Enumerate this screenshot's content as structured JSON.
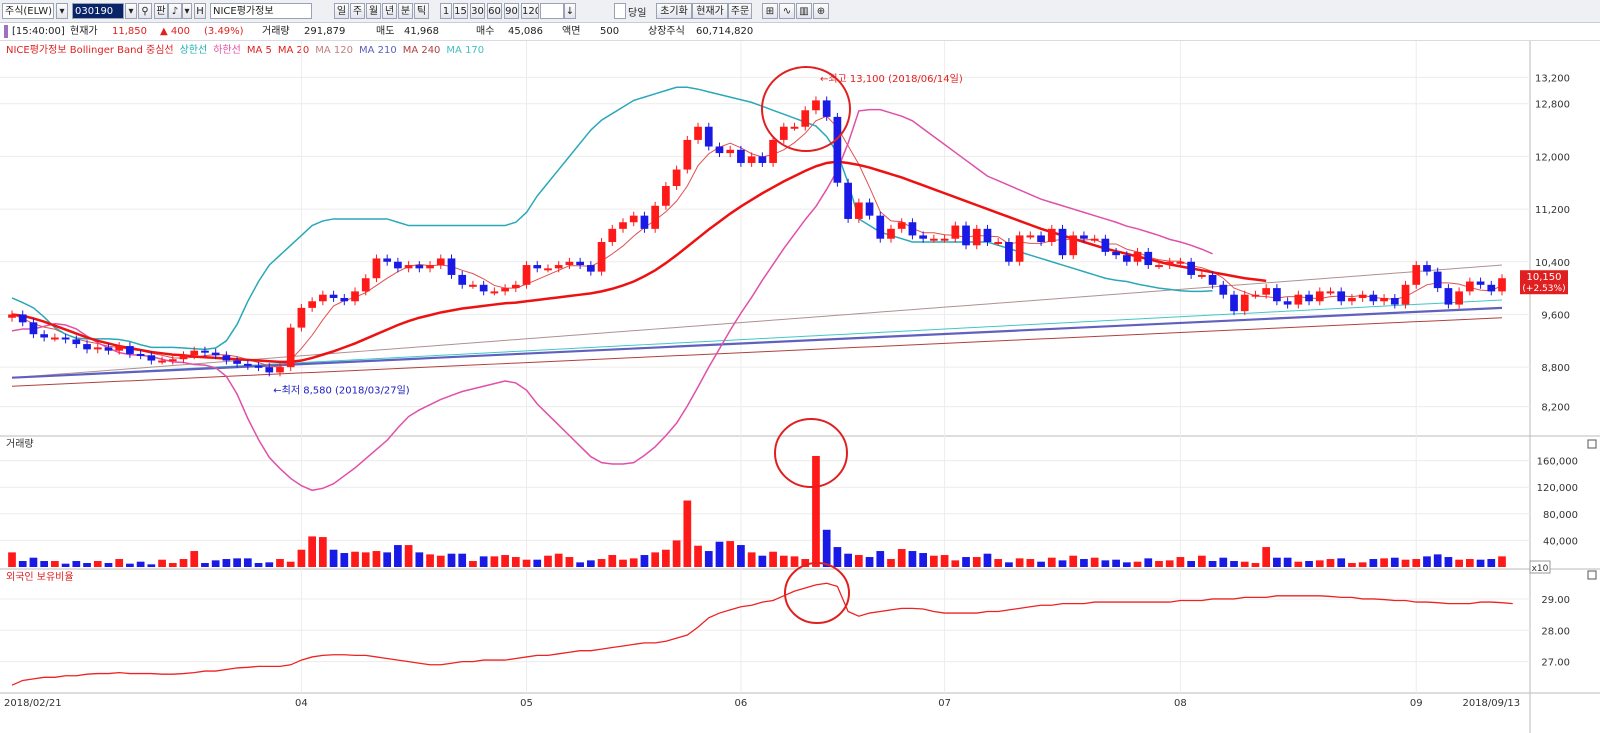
{
  "toolbar": {
    "market_select": "주식(ELW)",
    "code_input": "030190",
    "type_label": "판",
    "name_input": "NICE평가정보",
    "periods": [
      "일",
      "주",
      "월",
      "년",
      "분",
      "틱"
    ],
    "intervals": [
      "1",
      "15",
      "30",
      "60",
      "90",
      "120"
    ],
    "count_field": "",
    "today_label": "당일",
    "reset_label": "초기화",
    "current_price_label": "현재가",
    "order_label": "주문"
  },
  "infobar": {
    "time": "[15:40:00]",
    "price_label": "현재가",
    "price": "11,850",
    "change": "▲ 400",
    "change_pct": "(3.49%)",
    "volume_label": "거래량",
    "volume": "291,879",
    "sell_label": "매도",
    "sell": "41,968",
    "buy_label": "매수",
    "buy": "45,086",
    "par_label": "액면",
    "par": "500",
    "listed_label": "상장주식",
    "listed": "60,714,820"
  },
  "legend": [
    {
      "text": "NICE평가정보 Bollinger Band 중심선",
      "color": "#e02020"
    },
    {
      "text": "상한선",
      "color": "#20b0b0"
    },
    {
      "text": "하한선",
      "color": "#e050a0"
    },
    {
      "text": "MA 5",
      "color": "#e02020"
    },
    {
      "text": "MA 20",
      "color": "#e02020"
    },
    {
      "text": "MA 120",
      "color": "#c08080"
    },
    {
      "text": "MA 210",
      "color": "#6060c0"
    },
    {
      "text": "MA 240",
      "color": "#b04040"
    },
    {
      "text": "MA 170",
      "color": "#40c0c0"
    }
  ],
  "panels": {
    "volume_title": "거래량",
    "foreign_title": "외국인 보유비율",
    "volume_unit": "x10"
  },
  "colors": {
    "up": "#ff1a1a",
    "down": "#1a1ae6",
    "upper": "#2aa8b8",
    "lower": "#e050a8",
    "mid": "#ee1111"
  },
  "chart_data": [
    {
      "type": "candlestick",
      "title": "NICE평가정보",
      "ylim": [
        7800,
        13600
      ],
      "yticks": [
        8200,
        8800,
        9600,
        10400,
        11200,
        12000,
        12800,
        13200
      ],
      "ytick_labels": [
        "8,200",
        "8,800",
        "9,600",
        "10,400",
        "11,200",
        "12,000",
        "12,800",
        "13,200"
      ],
      "x_labels": [
        {
          "text": "2018/02/21",
          "index": 0
        },
        {
          "text": "04",
          "index": 27
        },
        {
          "text": "05",
          "index": 48
        },
        {
          "text": "06",
          "index": 68
        },
        {
          "text": "07",
          "index": 87
        },
        {
          "text": "08",
          "index": 109
        },
        {
          "text": "09",
          "index": 131
        },
        {
          "text": "2018/09/13",
          "index": 138
        }
      ],
      "last_price_label": "10,150",
      "last_change_label": "(+2.53%)",
      "annotations": [
        {
          "text": "←최고 13,100 (2018/06/14일)",
          "index": 75,
          "value": 13100
        },
        {
          "text": "←최저 8,580 (2018/03/27일)",
          "index": 24,
          "value": 8580
        }
      ],
      "close": [
        9600,
        9480,
        9300,
        9250,
        9250,
        9220,
        9150,
        9070,
        9100,
        9050,
        9120,
        9000,
        8980,
        8900,
        8900,
        8920,
        8980,
        9050,
        9020,
        8980,
        8900,
        8850,
        8820,
        8800,
        8720,
        8800,
        9400,
        9700,
        9800,
        9900,
        9850,
        9800,
        9950,
        10150,
        10450,
        10400,
        10300,
        10350,
        10300,
        10350,
        10450,
        10200,
        10050,
        10050,
        9950,
        9950,
        10000,
        10050,
        10350,
        10300,
        10300,
        10350,
        10400,
        10350,
        10250,
        10700,
        10900,
        11000,
        11100,
        10900,
        11250,
        11550,
        11800,
        12250,
        12450,
        12150,
        12050,
        12100,
        11900,
        12000,
        11900,
        12250,
        12450,
        12450,
        12700,
        12850,
        12600,
        11600,
        11050,
        11300,
        11100,
        10750,
        10900,
        11000,
        10800,
        10750,
        10750,
        10750,
        10950,
        10650,
        10900,
        10700,
        10700,
        10400,
        10800,
        10800,
        10700,
        10900,
        10500,
        10800,
        10750,
        10750,
        10550,
        10500,
        10400,
        10550,
        10350,
        10350,
        10400,
        10400,
        10200,
        10200,
        10050,
        9900,
        9650,
        9900,
        9900,
        10000,
        9800,
        9750,
        9900,
        9800,
        9950,
        9950,
        9800,
        9850,
        9900,
        9800,
        9850,
        9750,
        10050,
        10350,
        10250,
        10000,
        9750,
        9950,
        10100,
        10050,
        9950,
        10150
      ],
      "open": [
        9550,
        9600,
        9480,
        9300,
        9250,
        9250,
        9220,
        9150,
        9070,
        9100,
        9050,
        9120,
        9000,
        8980,
        8900,
        8900,
        8920,
        8980,
        9050,
        9020,
        8980,
        8900,
        8850,
        8820,
        8800,
        8720,
        8800,
        9400,
        9700,
        9800,
        9900,
        9850,
        9800,
        9950,
        10150,
        10450,
        10400,
        10300,
        10350,
        10300,
        10350,
        10450,
        10200,
        10050,
        10050,
        9950,
        9950,
        10000,
        10050,
        10350,
        10300,
        10300,
        10350,
        10400,
        10350,
        10250,
        10700,
        10900,
        11000,
        11100,
        10900,
        11250,
        11550,
        11800,
        12250,
        12450,
        12150,
        12050,
        12100,
        11900,
        12000,
        11900,
        12250,
        12450,
        12450,
        12700,
        12850,
        12600,
        11600,
        11050,
        11300,
        11100,
        10750,
        10900,
        11000,
        10800,
        10750,
        10750,
        10750,
        10950,
        10650,
        10900,
        10700,
        10700,
        10400,
        10800,
        10800,
        10700,
        10900,
        10500,
        10800,
        10750,
        10750,
        10550,
        10500,
        10400,
        10550,
        10350,
        10350,
        10400,
        10400,
        10200,
        10200,
        10050,
        9900,
        9650,
        9900,
        9900,
        10000,
        9800,
        9750,
        9900,
        9800,
        9950,
        9950,
        9800,
        9850,
        9900,
        9800,
        9850,
        9750,
        10050,
        10350,
        10250,
        10000,
        9750,
        9950,
        10100,
        10050,
        9950
      ],
      "series": [
        {
          "name": "상한선",
          "values": [
            9850,
            9780,
            9700,
            9560,
            9400,
            9300,
            9240,
            9230,
            9230,
            9230,
            9220,
            9190,
            9140,
            9100,
            9100,
            9100,
            9090,
            9080,
            9070,
            9090,
            9200,
            9450,
            9800,
            10100,
            10350,
            10500,
            10650,
            10800,
            10950,
            11020,
            11050,
            11050,
            11050,
            11050,
            11050,
            11050,
            11000,
            10950,
            10950,
            10950,
            10950,
            10950,
            10950,
            10950,
            10950,
            10950,
            10950,
            11000,
            11150,
            11400,
            11600,
            11800,
            12000,
            12200,
            12400,
            12550,
            12650,
            12750,
            12850,
            12900,
            12950,
            13000,
            13050,
            13050,
            13020,
            12980,
            12940,
            12900,
            12860,
            12820,
            12760,
            12700,
            12640,
            12580,
            12520,
            12460,
            12300,
            12050,
            11600,
            11050,
            10950,
            10850,
            10800,
            10750,
            10700,
            10700,
            10700,
            10700,
            10700,
            10700,
            10700,
            10700,
            10650,
            10600,
            10550,
            10500,
            10450,
            10400,
            10350,
            10300,
            10250,
            10200,
            10150,
            10120,
            10100,
            10060,
            10030,
            10000,
            9980,
            9960,
            9950,
            9950,
            9960
          ]
        },
        {
          "name": "중심선",
          "values": [
            9600,
            9580,
            9540,
            9490,
            9430,
            9370,
            9310,
            9250,
            9200,
            9160,
            9120,
            9090,
            9060,
            9030,
            9010,
            8990,
            8980,
            8960,
            8950,
            8940,
            8930,
            8920,
            8910,
            8900,
            8890,
            8880,
            8880,
            8900,
            8940,
            8990,
            9040,
            9100,
            9160,
            9230,
            9300,
            9370,
            9440,
            9500,
            9550,
            9590,
            9630,
            9660,
            9690,
            9710,
            9730,
            9750,
            9770,
            9780,
            9800,
            9820,
            9840,
            9860,
            9880,
            9900,
            9920,
            9950,
            9990,
            10040,
            10100,
            10180,
            10270,
            10380,
            10500,
            10630,
            10760,
            10890,
            11010,
            11130,
            11240,
            11340,
            11440,
            11530,
            11620,
            11700,
            11780,
            11850,
            11900,
            11920,
            11900,
            11870,
            11830,
            11780,
            11730,
            11680,
            11620,
            11560,
            11500,
            11440,
            11380,
            11320,
            11260,
            11200,
            11140,
            11080,
            11020,
            10960,
            10900,
            10850,
            10800,
            10750,
            10700,
            10650,
            10600,
            10560,
            10520,
            10480,
            10440,
            10400,
            10360,
            10330,
            10300,
            10270,
            10240,
            10210,
            10180,
            10150,
            10130,
            10110
          ]
        }
      ]
    },
    {
      "type": "bar",
      "title": "거래량",
      "unit": "x10",
      "ylim": [
        0,
        185000
      ],
      "yticks": [
        40000,
        80000,
        120000,
        160000
      ],
      "ytick_labels": [
        "40,000",
        "80,000",
        "120,000",
        "160,000"
      ],
      "values": [
        22000,
        9000,
        14000,
        9000,
        9000,
        5000,
        9000,
        6000,
        9000,
        6000,
        12000,
        5000,
        8000,
        4000,
        11000,
        6000,
        12000,
        24000,
        6000,
        10000,
        12000,
        13000,
        13000,
        6000,
        7000,
        12000,
        8000,
        26000,
        46000,
        45000,
        26000,
        21000,
        23000,
        22000,
        24000,
        22000,
        33000,
        33000,
        22000,
        19000,
        17000,
        20000,
        20000,
        9000,
        16000,
        16000,
        18000,
        15000,
        11000,
        11000,
        17000,
        20000,
        15000,
        7000,
        10000,
        12000,
        18000,
        11000,
        13000,
        18000,
        22000,
        26000,
        40000,
        100000,
        32000,
        24000,
        38000,
        39000,
        33000,
        22000,
        17000,
        23000,
        17000,
        16000,
        12000,
        167000,
        56000,
        30000,
        20000,
        18000,
        15000,
        24000,
        12000,
        27000,
        24000,
        21000,
        17000,
        18000,
        10000,
        15000,
        15000,
        20000,
        12000,
        7000,
        13000,
        12000,
        8000,
        14000,
        10000,
        17000,
        12000,
        14000,
        10000,
        11000,
        7000,
        8000,
        13000,
        9000,
        10000,
        15000,
        9000,
        17000,
        9000,
        14000,
        9000,
        8000,
        6000,
        30000,
        14000,
        14000,
        8000,
        9000,
        10000,
        12000,
        13000,
        6000,
        7000,
        12000,
        13000,
        14000,
        11000,
        12000,
        16000,
        19000,
        15000,
        11000,
        12000,
        11000,
        12000,
        16000,
        11000,
        9000
      ]
    },
    {
      "type": "line",
      "title": "외국인 보유비율",
      "ylim": [
        26.0,
        29.7
      ],
      "yticks": [
        27.0,
        28.0,
        29.0
      ],
      "ytick_labels": [
        "27.00",
        "28.00",
        "29.00"
      ],
      "series": [
        {
          "name": "외국인 보유비율",
          "values": [
            26.25,
            26.4,
            26.45,
            26.5,
            26.5,
            26.55,
            26.55,
            26.6,
            26.62,
            26.62,
            26.65,
            26.62,
            26.62,
            26.62,
            26.6,
            26.6,
            26.62,
            26.65,
            26.7,
            26.7,
            26.75,
            26.8,
            26.82,
            26.85,
            26.85,
            26.85,
            26.9,
            27.05,
            27.15,
            27.2,
            27.22,
            27.22,
            27.2,
            27.2,
            27.15,
            27.1,
            27.05,
            27.0,
            26.95,
            26.9,
            26.9,
            26.95,
            27.0,
            27.0,
            27.05,
            27.05,
            27.05,
            27.1,
            27.15,
            27.2,
            27.2,
            27.25,
            27.3,
            27.35,
            27.35,
            27.4,
            27.45,
            27.5,
            27.55,
            27.6,
            27.6,
            27.65,
            27.75,
            27.85,
            28.1,
            28.4,
            28.55,
            28.65,
            28.75,
            28.8,
            28.9,
            28.95,
            29.1,
            29.25,
            29.35,
            29.45,
            29.5,
            29.4,
            28.6,
            28.45,
            28.55,
            28.6,
            28.65,
            28.7,
            28.7,
            28.68,
            28.6,
            28.55,
            28.55,
            28.55,
            28.55,
            28.6,
            28.6,
            28.65,
            28.7,
            28.75,
            28.8,
            28.8,
            28.85,
            28.85,
            28.85,
            28.9,
            28.9,
            28.9,
            28.9,
            28.9,
            28.9,
            28.9,
            28.9,
            28.95,
            28.95,
            28.95,
            29.0,
            29.0,
            29.0,
            29.05,
            29.05,
            29.05,
            29.1,
            29.1,
            29.1,
            29.1,
            29.1,
            29.08,
            29.05,
            29.05,
            29.0,
            29.0,
            28.98,
            28.95,
            28.95,
            28.9,
            28.9,
            28.88,
            28.85,
            28.85,
            28.85,
            28.9,
            28.9,
            28.88,
            28.85
          ]
        }
      ]
    }
  ]
}
